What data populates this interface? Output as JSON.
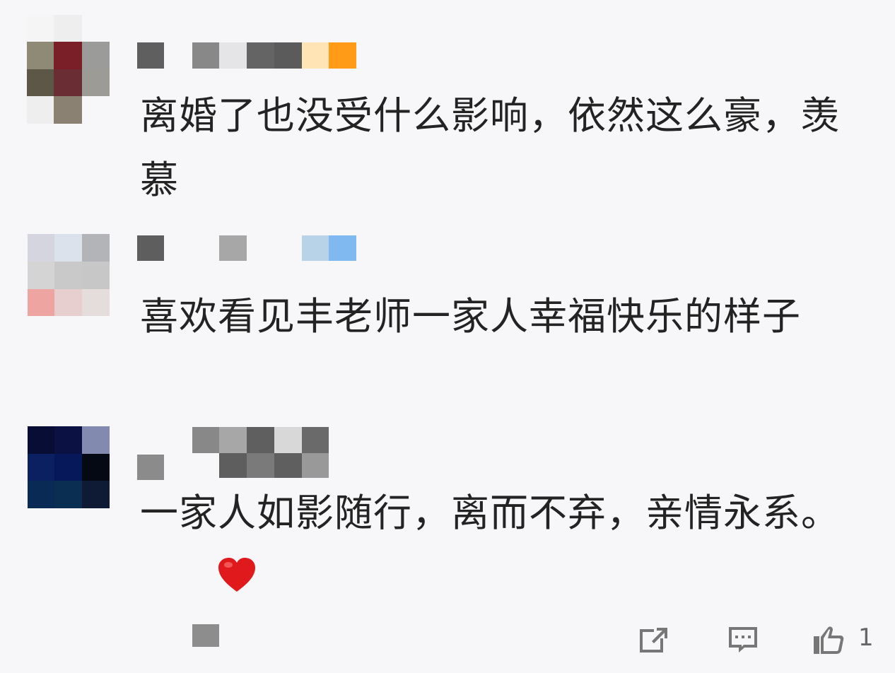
{
  "comments": [
    {
      "text": "离婚了也没受什么影响，依然这么豪，羡慕"
    },
    {
      "text": "喜欢看见丰老师一家人幸福快乐的样子"
    },
    {
      "text": "一家人如影随行，离而不弃，亲情永系。"
    }
  ],
  "actions": {
    "share_icon": "share-icon",
    "comment_icon": "comment-icon",
    "like_icon": "thumbs-up-icon",
    "like_count": "1"
  },
  "colors": {
    "background": "#f7f7f9",
    "text": "#232323",
    "icon": "#777777",
    "heart": "#e0191c"
  }
}
